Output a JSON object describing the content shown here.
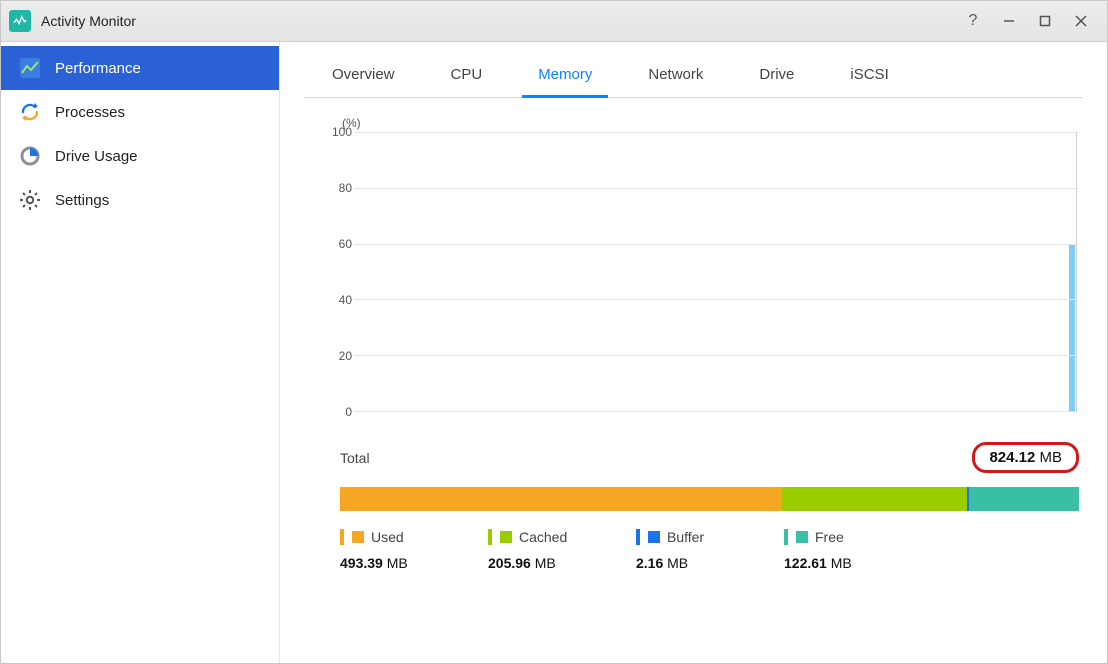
{
  "titlebar": {
    "app_name": "Activity Monitor"
  },
  "sidebar": {
    "items": [
      {
        "label": "Performance",
        "selected": true
      },
      {
        "label": "Processes",
        "selected": false
      },
      {
        "label": "Drive Usage",
        "selected": false
      },
      {
        "label": "Settings",
        "selected": false
      }
    ]
  },
  "tabs": [
    {
      "label": "Overview",
      "active": false
    },
    {
      "label": "CPU",
      "active": false
    },
    {
      "label": "Memory",
      "active": true
    },
    {
      "label": "Network",
      "active": false
    },
    {
      "label": "Drive",
      "active": false
    },
    {
      "label": "iSCSI",
      "active": false
    }
  ],
  "chart_data": {
    "type": "line",
    "title": "",
    "ylabel": "(%)",
    "xlabel": "",
    "ylim": [
      0,
      100
    ],
    "yticks": [
      0,
      20,
      40,
      60,
      80,
      100
    ],
    "series": [
      {
        "name": "memory-usage",
        "values": [
          60
        ],
        "color": "#7ecdfb"
      }
    ],
    "note": "Single rightmost sample shown at ~60%"
  },
  "memory": {
    "total": {
      "label": "Total",
      "value": "824.12",
      "unit": "MB"
    },
    "breakdown": [
      {
        "key": "used",
        "label": "Used",
        "value": "493.39",
        "unit": "MB",
        "color": "#f5a623"
      },
      {
        "key": "cached",
        "label": "Cached",
        "value": "205.96",
        "unit": "MB",
        "color": "#9acd00"
      },
      {
        "key": "buffer",
        "label": "Buffer",
        "value": "2.16",
        "unit": "MB",
        "color": "#1a73e8"
      },
      {
        "key": "free",
        "label": "Free",
        "value": "122.61",
        "unit": "MB",
        "color": "#3bbfa2"
      }
    ]
  },
  "annotation": {
    "total_highlighted": true
  }
}
